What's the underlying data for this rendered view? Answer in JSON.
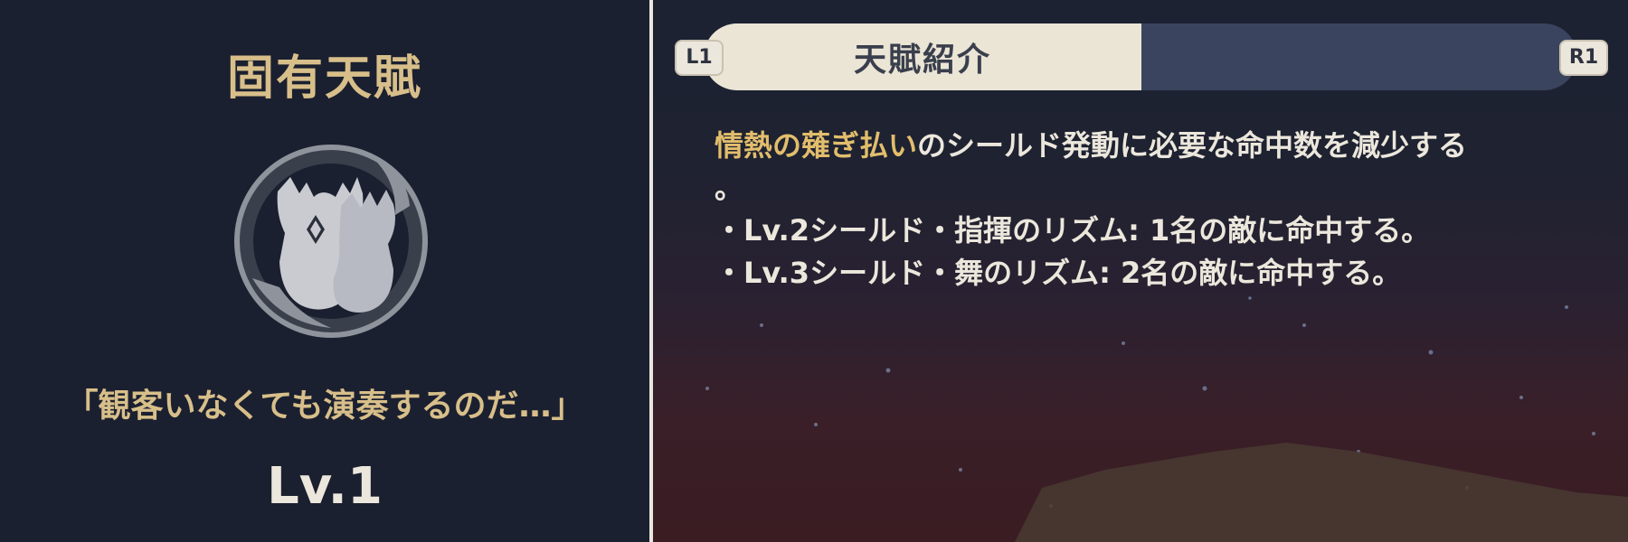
{
  "left_panel": {
    "talent_type": "固有天賦",
    "emblem_icon": "dual-horned-shield-emblem-icon",
    "quote": "「観客いなくても演奏するのだ…」",
    "level": "Lv.1"
  },
  "right_panel": {
    "tabs": {
      "active_label": "天賦紹介",
      "inactive_label": ""
    },
    "shoulder_buttons": {
      "left": "L1",
      "right": "R1"
    },
    "description": {
      "line1_highlight": "情熱の薙ぎ払い",
      "line1_rest": "のシールド発動に必要な命中数を減少する",
      "line2": "。",
      "line3": "・Lv.2シールド・指揮のリズム: 1名の敵に命中する。",
      "line4": "・Lv.3シールド・舞のリズム: 2名の敵に命中する。"
    }
  },
  "colors": {
    "left_background": "#1b2030",
    "gold_text": "#d8bf8a",
    "highlight_text": "#e2bd6c",
    "body_text": "#ece7dc",
    "tab_active": "#ebe5d6",
    "tab_inactive": "#3a445e"
  }
}
